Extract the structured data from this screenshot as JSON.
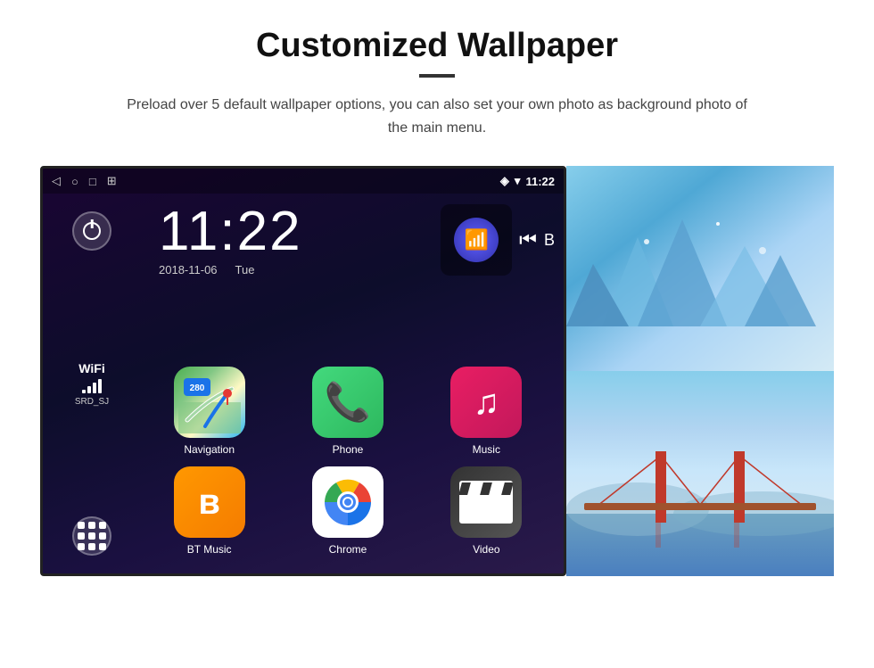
{
  "page": {
    "title": "Customized Wallpaper",
    "subtitle": "Preload over 5 default wallpaper options, you can also set your own photo as background photo of the main menu."
  },
  "status_bar": {
    "time": "11:22",
    "nav_icons": [
      "◁",
      "○",
      "□",
      "⊞"
    ],
    "right_icons": [
      "location",
      "wifi",
      "time"
    ]
  },
  "clock": {
    "time": "11:22",
    "date": "2018-11-06",
    "day": "Tue"
  },
  "wifi": {
    "label": "WiFi",
    "ssid": "SRD_SJ"
  },
  "apps": [
    {
      "id": "navigation",
      "label": "Navigation",
      "badge": "280"
    },
    {
      "id": "phone",
      "label": "Phone"
    },
    {
      "id": "music",
      "label": "Music"
    },
    {
      "id": "bt-music",
      "label": "BT Music"
    },
    {
      "id": "chrome",
      "label": "Chrome"
    },
    {
      "id": "video",
      "label": "Video"
    }
  ],
  "wallpapers": [
    {
      "id": "ice",
      "label": "Ice wallpaper"
    },
    {
      "id": "bridge",
      "label": "Bridge wallpaper"
    }
  ]
}
